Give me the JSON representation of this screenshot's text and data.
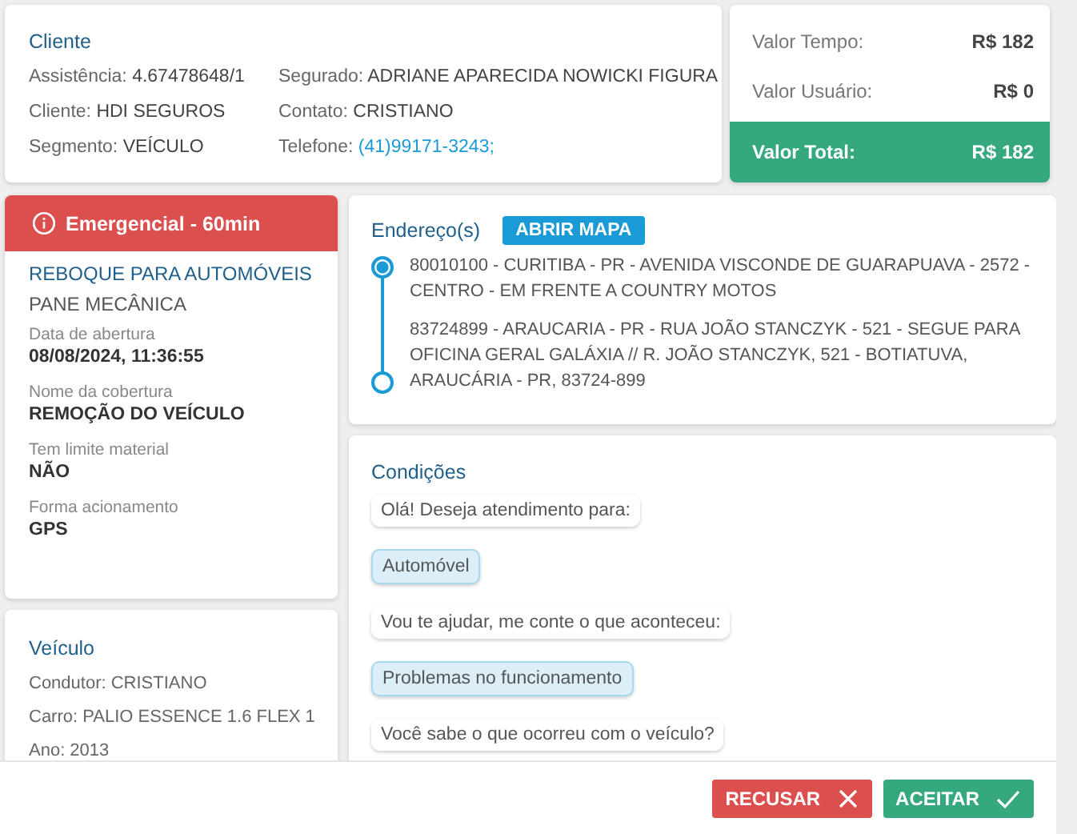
{
  "cliente": {
    "title": "Cliente",
    "fields": [
      {
        "label": "Assistência:",
        "value": "4.67478648/1",
        "kind": "text"
      },
      {
        "label": "Segurado:",
        "value": "ADRIANE APARECIDA NOWICKI FIGURA",
        "kind": "text"
      },
      {
        "label": "Cliente:",
        "value": "HDI SEGUROS",
        "kind": "text"
      },
      {
        "label": "Contato:",
        "value": "CRISTIANO",
        "kind": "text"
      },
      {
        "label": "Segmento:",
        "value": "VEÍCULO",
        "kind": "text"
      },
      {
        "label": "Telefone:",
        "value": "(41)99171-3243;",
        "kind": "link"
      }
    ]
  },
  "valores": {
    "rows": [
      {
        "label": "Valor Tempo:",
        "value": "R$ 182"
      },
      {
        "label": "Valor Usuário:",
        "value": "R$ 0"
      }
    ],
    "total": {
      "label": "Valor Total:",
      "value": "R$ 182"
    }
  },
  "servico": {
    "badge": "Emergencial - 60min",
    "title": "REBOQUE PARA AUTOMÓVEIS",
    "subtitle": "PANE MECÂNICA",
    "details": [
      {
        "label": "Data de abertura",
        "value": "08/08/2024, 11:36:55"
      },
      {
        "label": "Nome da cobertura",
        "value": "REMOÇÃO DO VEÍCULO"
      },
      {
        "label": "Tem limite material",
        "value": "NÃO"
      },
      {
        "label": "Forma acionamento",
        "value": "GPS"
      }
    ]
  },
  "veiculo": {
    "title": "Veículo",
    "lines": [
      "Condutor: CRISTIANO",
      "Carro: PALIO ESSENCE 1.6 FLEX 1",
      "Ano: 2013"
    ]
  },
  "enderecos": {
    "title": "Endereço(s)",
    "button": "ABRIR MAPA",
    "stops": [
      {
        "text": "80010100 - CURITIBA - PR - AVENIDA VISCONDE DE GUARAPUAVA - 2572 - CENTRO - EM FRENTE A COUNTRY MOTOS",
        "selected": true
      },
      {
        "text": "83724899 - ARAUCARIA - PR - RUA JOÃO STANCZYK - 521 - SEGUE PARA OFICINA GERAL GALÁXIA // R. JOÃO STANCZYK, 521 - BOTIATUVA, ARAUCÁRIA - PR, 83724-899",
        "selected": false
      }
    ]
  },
  "condicoes": {
    "title": "Condições",
    "messages": [
      {
        "kind": "question",
        "text": "Olá! Deseja atendimento para:"
      },
      {
        "kind": "answer",
        "text": "Automóvel"
      },
      {
        "kind": "question",
        "text": "Vou te ajudar, me conte o que aconteceu:"
      },
      {
        "kind": "answer",
        "text": "Problemas no funcionamento"
      },
      {
        "kind": "question",
        "text": "Você sabe o que ocorreu com o veículo?"
      }
    ]
  },
  "footer": {
    "buttons": [
      {
        "label": "RECUSAR",
        "kind": "reject"
      },
      {
        "label": "ACEITAR",
        "kind": "accept"
      }
    ]
  }
}
